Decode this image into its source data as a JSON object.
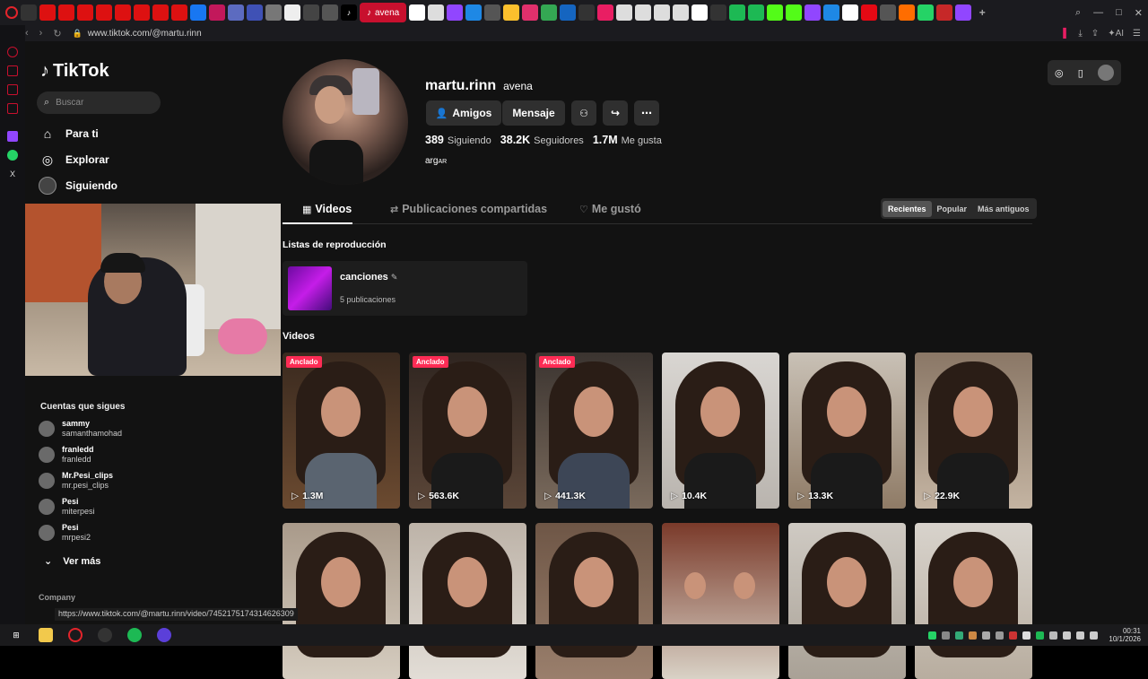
{
  "browser": {
    "active_tab_label": "avena",
    "url": "www.tiktok.com/@martu.rinn",
    "ai_label": "AI",
    "hover_link": "https://www.tiktok.com/@martu.rinn/video/7452175174314626309"
  },
  "sidebar": {
    "logo": "TikTok",
    "search_placeholder": "Buscar",
    "nav": [
      {
        "label": "Para ti",
        "icon": "home-icon"
      },
      {
        "label": "Explorar",
        "icon": "compass-icon"
      },
      {
        "label": "Siguiendo",
        "icon": "following-avatar-icon"
      }
    ],
    "follows_title": "Cuentas que sigues",
    "follows": [
      {
        "name": "sammy",
        "handle": "samanthamohad"
      },
      {
        "name": "franledd",
        "handle": "franledd"
      },
      {
        "name": "Mr.Pesi_clips",
        "handle": "mr.pesi_clips"
      },
      {
        "name": "Pesi",
        "handle": "miterpesi"
      },
      {
        "name": "Pesi",
        "handle": "mrpesi2"
      }
    ],
    "see_more": "Ver más",
    "company": "Company"
  },
  "profile": {
    "username": "martu.rinn",
    "nickname": "avena",
    "buttons": {
      "friends": "Amigos",
      "message": "Mensaje"
    },
    "stats": {
      "following_count": "389",
      "following_label": "Siguiendo",
      "followers_count": "38.2K",
      "followers_label": "Seguidores",
      "likes_count": "1.7M",
      "likes_label": "Me gusta"
    },
    "bio_main": "arg",
    "bio_small": "AR"
  },
  "tabs": {
    "videos": "Videos",
    "reposts": "Publicaciones compartidas",
    "liked": "Me gustó"
  },
  "sort": {
    "recent": "Recientes",
    "popular": "Popular",
    "oldest": "Más antiguos"
  },
  "playlists": {
    "title": "Listas de reproducción",
    "items": [
      {
        "name": "canciones",
        "count": "5 publicaciones"
      }
    ]
  },
  "videos": {
    "title": "Videos",
    "pinned_label": "Anclado",
    "row1": [
      {
        "views": "1.3M",
        "pinned": true
      },
      {
        "views": "563.6K",
        "pinned": true
      },
      {
        "views": "441.3K",
        "pinned": true
      },
      {
        "views": "10.4K",
        "pinned": false
      },
      {
        "views": "13.3K",
        "pinned": false
      },
      {
        "views": "22.9K",
        "pinned": false
      }
    ]
  },
  "taskbar": {
    "time": "00:31",
    "date": "10/1/2026"
  },
  "colors": {
    "accent": "#fe2c55",
    "page_bg": "#121212",
    "opera_red": "#c8102e"
  }
}
